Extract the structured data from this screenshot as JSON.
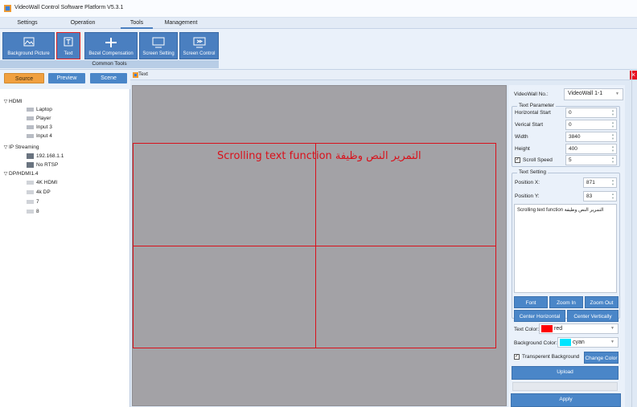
{
  "window": {
    "title": "VideoWall Control Software Platform V5.3.1"
  },
  "menu": {
    "tabs": [
      {
        "label": "Settings"
      },
      {
        "label": "Operation"
      },
      {
        "label": "Tools"
      },
      {
        "label": "Management"
      }
    ]
  },
  "ribbon": {
    "buttons": [
      {
        "label": "Background Picture",
        "icon": "picture-icon"
      },
      {
        "label": "Text",
        "icon": "text-icon"
      },
      {
        "label": "Bezel Compensation",
        "icon": "bezel-icon"
      },
      {
        "label": "Screen Setting",
        "icon": "monitor-icon"
      },
      {
        "label": "Screen Control",
        "icon": "screen-control-icon"
      }
    ],
    "group_label": "Common Tools"
  },
  "left_panel": {
    "tabs": [
      {
        "label": "Source"
      },
      {
        "label": "Preview"
      },
      {
        "label": "Scene"
      }
    ],
    "tree": [
      {
        "label": "HDMI"
      },
      {
        "label": "Laptop"
      },
      {
        "label": "Player"
      },
      {
        "label": "Input 3"
      },
      {
        "label": "Input 4"
      },
      {
        "label": "IP Streaming"
      },
      {
        "label": "192.168.1.1"
      },
      {
        "label": "No RTSP"
      },
      {
        "label": "DP/HDMI1.4"
      },
      {
        "label": "4K HDMI"
      },
      {
        "label": "4k DP"
      },
      {
        "label": "7"
      },
      {
        "label": "8"
      }
    ]
  },
  "dialog": {
    "title": "Text",
    "close_symbol": "×",
    "canvas_text": "Scrolling text function التمرير النص وظيفة",
    "videowall_no_label": "VideoWall No.:",
    "videowall_no_value": "VideoWall 1-1",
    "text_parameter": {
      "legend": "Text Parameter",
      "horizontal_start_label": "Horizontal Start",
      "horizontal_start": "0",
      "vertical_start_label": "Verical Start",
      "vertical_start": "0",
      "width_label": "Width",
      "width": "3840",
      "height_label": "Height",
      "height": "400",
      "scroll_speed_label": "Scroll Speed",
      "scroll_speed": "5"
    },
    "text_setting": {
      "legend": "Text Setting",
      "position_x_label": "Position X:",
      "position_x": "871",
      "position_y_label": "Position Y:",
      "position_y": "83",
      "text_content": "Scrolling text function التمرير النص وظيفة"
    },
    "buttons": {
      "font": "Font",
      "zoom_in": "Zoom In",
      "zoom_out": "Zoom Out",
      "center_horizontal": "Center Horizontal",
      "center_vertically": "Center Vertically",
      "change_color": "Change Color",
      "upload": "Upload",
      "apply": "Apply"
    },
    "text_color_label": "Text Color:",
    "text_color_value": "red",
    "background_color_label": "Background Color:",
    "background_color_value": "cyan",
    "transparent_bg_label": "Transperent Background"
  },
  "colors": {
    "accent_blue": "#4a86c8",
    "highlight_red": "#e02020",
    "text_color_swatch": "#ff0000",
    "bg_color_swatch": "#00e5ff",
    "source_tab": "#f0a040"
  }
}
